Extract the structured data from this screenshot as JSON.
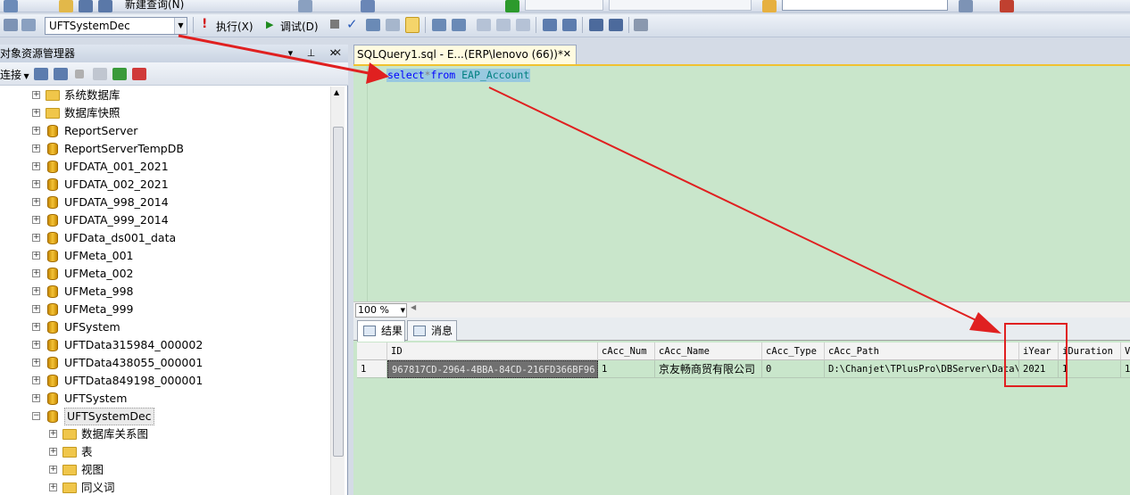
{
  "toolbar": {
    "new_query_label": "新建查询(N)",
    "database_combo_value": "UFTSystemDec",
    "execute_label": "执行(X)",
    "debug_label": "调试(D)"
  },
  "object_explorer": {
    "title": "对象资源管理器",
    "connect_label": "连接",
    "title_controls": "▾ ⊥ ✕",
    "tree": [
      {
        "label": "系统数据库",
        "type": "folder",
        "expander": "+"
      },
      {
        "label": "数据库快照",
        "type": "folder",
        "expander": "+"
      },
      {
        "label": "ReportServer",
        "type": "db",
        "expander": "+"
      },
      {
        "label": "ReportServerTempDB",
        "type": "db",
        "expander": "+"
      },
      {
        "label": "UFDATA_001_2021",
        "type": "db",
        "expander": "+"
      },
      {
        "label": "UFDATA_002_2021",
        "type": "db",
        "expander": "+"
      },
      {
        "label": "UFDATA_998_2014",
        "type": "db",
        "expander": "+"
      },
      {
        "label": "UFDATA_999_2014",
        "type": "db",
        "expander": "+"
      },
      {
        "label": "UFData_ds001_data",
        "type": "db",
        "expander": "+"
      },
      {
        "label": "UFMeta_001",
        "type": "db",
        "expander": "+"
      },
      {
        "label": "UFMeta_002",
        "type": "db",
        "expander": "+"
      },
      {
        "label": "UFMeta_998",
        "type": "db",
        "expander": "+"
      },
      {
        "label": "UFMeta_999",
        "type": "db",
        "expander": "+"
      },
      {
        "label": "UFSystem",
        "type": "db",
        "expander": "+"
      },
      {
        "label": "UFTData315984_000002",
        "type": "db",
        "expander": "+"
      },
      {
        "label": "UFTData438055_000001",
        "type": "db",
        "expander": "+"
      },
      {
        "label": "UFTData849198_000001",
        "type": "db",
        "expander": "+"
      },
      {
        "label": "UFTSystem",
        "type": "db",
        "expander": "+"
      },
      {
        "label": "UFTSystemDec",
        "type": "db",
        "expander": "−",
        "selected": true
      },
      {
        "label": "数据库关系图",
        "type": "folder",
        "expander": "+",
        "child": true
      },
      {
        "label": "表",
        "type": "folder",
        "expander": "+",
        "child": true
      },
      {
        "label": "视图",
        "type": "folder",
        "expander": "+",
        "child": true
      },
      {
        "label": "同义词",
        "type": "folder",
        "expander": "+",
        "child": true
      }
    ]
  },
  "editor": {
    "tab_title": "SQLQuery1.sql - E...(ERP\\lenovo (66))*",
    "sql_keyword_select": "select",
    "sql_star": "*",
    "sql_keyword_from": "from",
    "sql_object": "EAP_Account",
    "zoom": "100 %"
  },
  "results": {
    "tab_results": "结果",
    "tab_messages": "消息",
    "columns": [
      "ID",
      "cAcc_Num",
      "cAcc_Name",
      "cAcc_Type",
      "cAcc_Path",
      "iYear",
      "iDuration",
      "Ve"
    ],
    "rows": [
      {
        "rownum": "1",
        "cells": [
          "967817CD-2964-4BBA-84CD-216FD366BF96",
          "1",
          "京友畅商贸有限公司",
          "0",
          "D:\\Chanjet\\TPlusPro\\DBServer\\Data\\",
          "2021",
          "1",
          "1"
        ]
      }
    ]
  },
  "colors": {
    "editor_bg": "#c9e6cb",
    "annotation_red": "#e02020",
    "sql_keyword": "#0000ff",
    "sql_object": "#008080"
  }
}
